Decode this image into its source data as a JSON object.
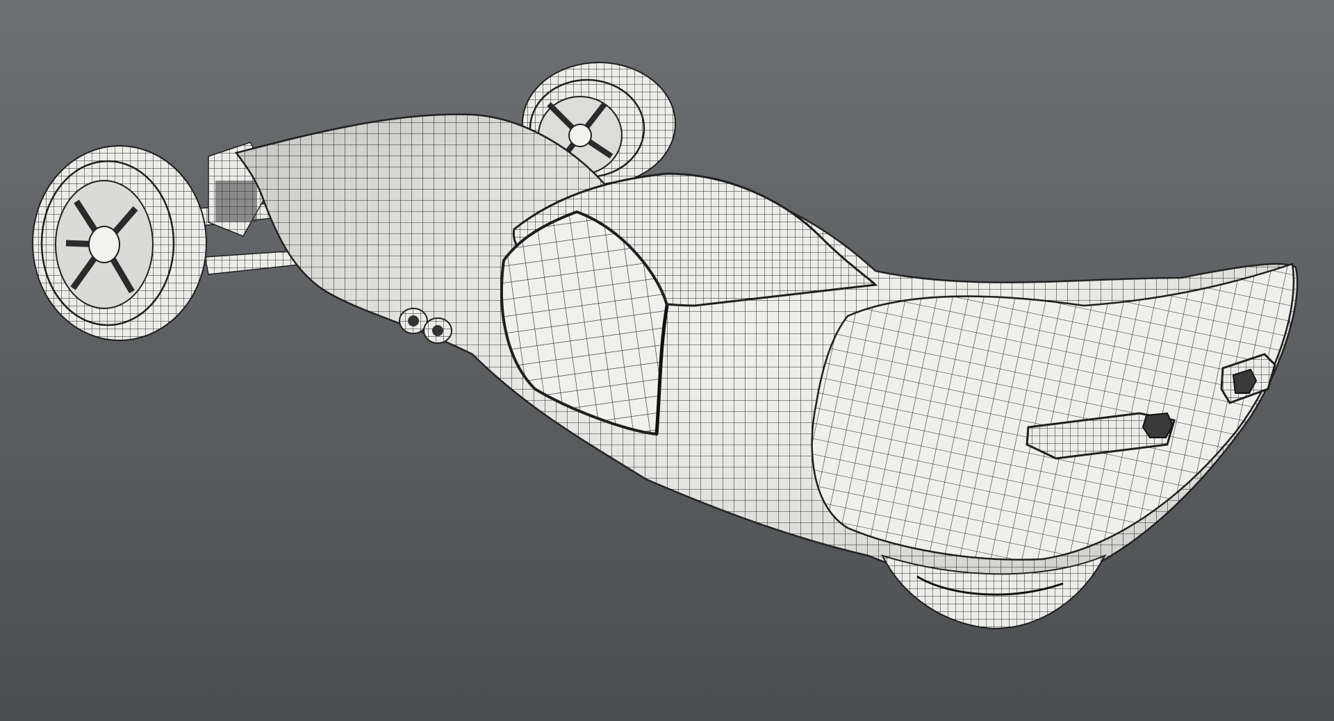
{
  "scene": {
    "background_top": "#6d7073",
    "background_bottom": "#4b4e50",
    "model_fill": "#eeeeea",
    "wire_color": "#1e1f20",
    "objects": [
      "car-body",
      "cockpit-canopy",
      "rear-left-wheel",
      "rear-right-wheel",
      "front-wheel",
      "suspension-arm",
      "exhaust-pipes",
      "tail-light-left",
      "tail-light-right",
      "rear-spoiler"
    ]
  }
}
